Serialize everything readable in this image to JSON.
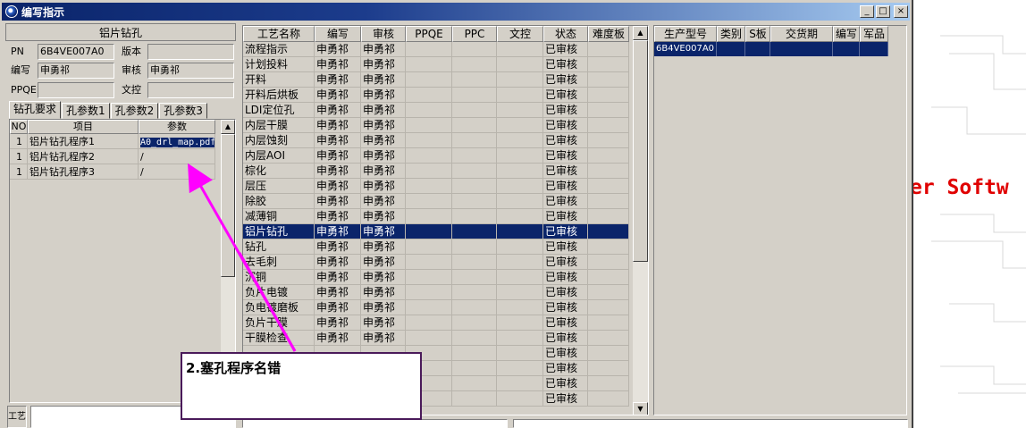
{
  "window": {
    "title": "编写指示",
    "min": "_",
    "max": "□",
    "close": "×"
  },
  "background_text": "er Softw",
  "left": {
    "header": "铝片钻孔",
    "fields": {
      "pn_label": "PN",
      "pn_value": "6B4VE007A0",
      "version_label": "版本",
      "version_value": "",
      "author_label": "编写",
      "author_value": "申勇祁",
      "review_label": "审核",
      "review_value": "申勇祁",
      "ppqe_label": "PPQE",
      "ppqe_value": "",
      "doc_label": "文控",
      "doc_value": ""
    },
    "tabs": [
      "钻孔要求",
      "孔参数1",
      "孔参数2",
      "孔参数3"
    ],
    "grid": {
      "columns": [
        "NO",
        "项目",
        "参数"
      ],
      "rows": [
        [
          "1",
          "铝片钻孔程序1",
          "A0_drl_map.pdf"
        ],
        [
          "1",
          "铝片钻孔程序2",
          "/"
        ],
        [
          "1",
          "铝片钻孔程序3",
          "/"
        ]
      ]
    },
    "bottom_label": "工艺"
  },
  "middle": {
    "columns": [
      "工艺名称",
      "编写",
      "审核",
      "PPQE",
      "PPC",
      "文控",
      "状态",
      "难度板"
    ],
    "rows": [
      [
        "流程指示",
        "申勇祁",
        "申勇祁",
        "",
        "",
        "",
        "已审核",
        ""
      ],
      [
        "计划投料",
        "申勇祁",
        "申勇祁",
        "",
        "",
        "",
        "已审核",
        ""
      ],
      [
        "开料",
        "申勇祁",
        "申勇祁",
        "",
        "",
        "",
        "已审核",
        ""
      ],
      [
        "开料后烘板",
        "申勇祁",
        "申勇祁",
        "",
        "",
        "",
        "已审核",
        ""
      ],
      [
        "LDI定位孔",
        "申勇祁",
        "申勇祁",
        "",
        "",
        "",
        "已审核",
        ""
      ],
      [
        "内层干膜",
        "申勇祁",
        "申勇祁",
        "",
        "",
        "",
        "已审核",
        ""
      ],
      [
        "内层蚀刻",
        "申勇祁",
        "申勇祁",
        "",
        "",
        "",
        "已审核",
        ""
      ],
      [
        "内层AOI",
        "申勇祁",
        "申勇祁",
        "",
        "",
        "",
        "已审核",
        ""
      ],
      [
        "棕化",
        "申勇祁",
        "申勇祁",
        "",
        "",
        "",
        "已审核",
        ""
      ],
      [
        "层压",
        "申勇祁",
        "申勇祁",
        "",
        "",
        "",
        "已审核",
        ""
      ],
      [
        "除胶",
        "申勇祁",
        "申勇祁",
        "",
        "",
        "",
        "已审核",
        ""
      ],
      [
        "减薄铜",
        "申勇祁",
        "申勇祁",
        "",
        "",
        "",
        "已审核",
        ""
      ],
      [
        "铝片钻孔",
        "申勇祁",
        "申勇祁",
        "",
        "",
        "",
        "已审核",
        ""
      ],
      [
        "钻孔",
        "申勇祁",
        "申勇祁",
        "",
        "",
        "",
        "已审核",
        ""
      ],
      [
        "去毛刺",
        "申勇祁",
        "申勇祁",
        "",
        "",
        "",
        "已审核",
        ""
      ],
      [
        "沉铜",
        "申勇祁",
        "申勇祁",
        "",
        "",
        "",
        "已审核",
        ""
      ],
      [
        "负片电镀",
        "申勇祁",
        "申勇祁",
        "",
        "",
        "",
        "已审核",
        ""
      ],
      [
        "负电镀磨板",
        "申勇祁",
        "申勇祁",
        "",
        "",
        "",
        "已审核",
        ""
      ],
      [
        "负片干膜",
        "申勇祁",
        "申勇祁",
        "",
        "",
        "",
        "已审核",
        ""
      ],
      [
        "干膜检查",
        "申勇祁",
        "申勇祁",
        "",
        "",
        "",
        "已审核",
        ""
      ],
      [
        "",
        "",
        "",
        "",
        "",
        "",
        "已审核",
        ""
      ],
      [
        "",
        "",
        "",
        "",
        "",
        "",
        "已审核",
        ""
      ],
      [
        "",
        "",
        "",
        "",
        "",
        "",
        "已审核",
        ""
      ],
      [
        "",
        "",
        "",
        "",
        "",
        "",
        "已审核",
        ""
      ]
    ],
    "selected_index": 12
  },
  "right": {
    "columns": [
      "生产型号",
      "类别",
      "S板",
      "交货期",
      "编写",
      "军品"
    ],
    "rows": [
      [
        "6B4VE007A0",
        "",
        "",
        "",
        "",
        ""
      ]
    ]
  },
  "callout": {
    "text": "2.塞孔程序名错",
    "color": "#ff00ff"
  }
}
